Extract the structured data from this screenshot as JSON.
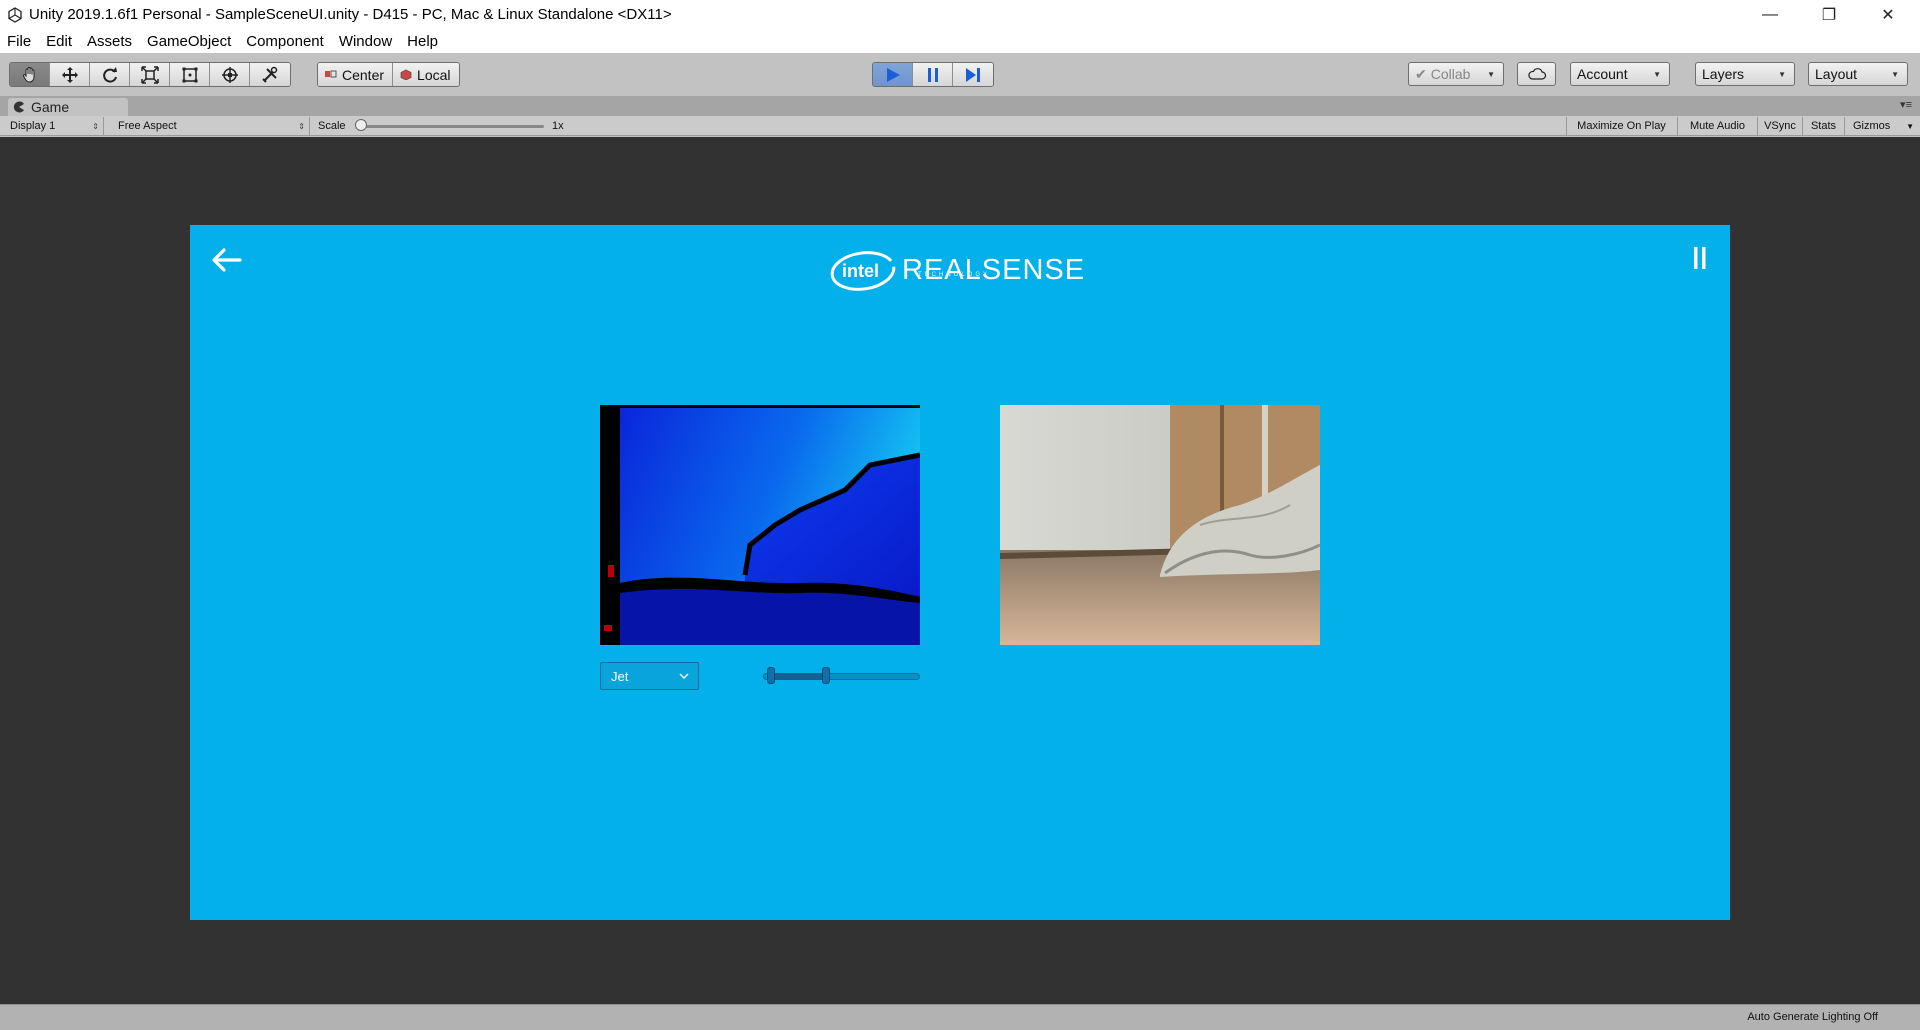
{
  "window": {
    "title": "Unity 2019.1.6f1 Personal - SampleSceneUI.unity - D415 - PC, Mac & Linux Standalone <DX11>",
    "minimize_glyph": "—",
    "restore_glyph": "❐",
    "close_glyph": "✕"
  },
  "menu": {
    "items": [
      "File",
      "Edit",
      "Assets",
      "GameObject",
      "Component",
      "Window",
      "Help"
    ]
  },
  "toolbar": {
    "transform_tools": [
      "hand-tool",
      "move-tool",
      "rotate-tool",
      "scale-tool",
      "rect-tool",
      "transform-tool",
      "custom-tool"
    ],
    "active_tool": "hand-tool",
    "pivot_label": "Center",
    "space_label": "Local",
    "play_state": "playing",
    "collab_label": "Collab",
    "account_label": "Account",
    "layers_label": "Layers",
    "layout_label": "Layout"
  },
  "game_tab": {
    "label": "Game"
  },
  "game_bar": {
    "display": "Display 1",
    "aspect": "Free Aspect",
    "scale_label": "Scale",
    "scale_value": "1x",
    "scale_fraction": 0,
    "toggles": [
      "Maximize On Play",
      "Mute Audio",
      "VSync",
      "Stats",
      "Gizmos"
    ]
  },
  "game_ui": {
    "brand_text": "REALSENSE",
    "brand_sub": "TECHNOLOGY",
    "intel_text": "intel",
    "colormap_value": "Jet",
    "range_min_fraction": 0.05,
    "range_max_fraction": 0.4,
    "background_color": "#03b0ea"
  },
  "status": {
    "text": "Auto Generate Lighting Off"
  }
}
